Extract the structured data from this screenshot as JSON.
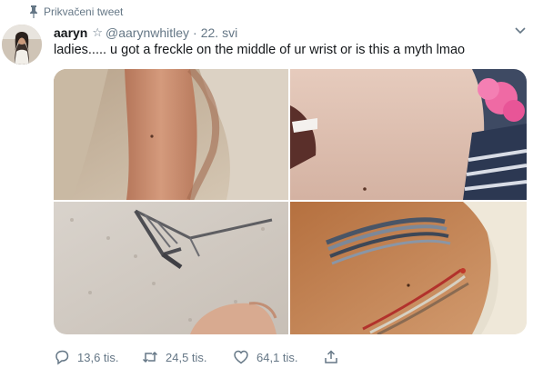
{
  "pinned": {
    "label": "Prikvačeni tweet",
    "icon": "pin-icon"
  },
  "tweet": {
    "display_name": "aaryn",
    "badge": "☆",
    "handle": "@aarynwhitley",
    "separator": "·",
    "timestamp": "22. svi",
    "text": "ladies..... u got a freckle on the middle of ur wrist or is this a myth lmao",
    "menu_icon": "chevron-down-icon"
  },
  "media": {
    "photos": [
      {
        "name": "photo-wrist-1",
        "description_icon": "photo"
      },
      {
        "name": "photo-wrist-2",
        "description_icon": "photo"
      },
      {
        "name": "photo-wrist-3",
        "description_icon": "photo"
      },
      {
        "name": "photo-wrist-4",
        "description_icon": "photo"
      }
    ]
  },
  "actions": {
    "reply_count": "13,6 tis.",
    "retweet_count": "24,5 tis.",
    "like_count": "64,1 tis.",
    "icons": [
      "reply-icon",
      "retweet-icon",
      "like-icon",
      "share-icon"
    ]
  },
  "colors": {
    "text": "#14171a",
    "secondary": "#657786",
    "background": "#ffffff"
  }
}
